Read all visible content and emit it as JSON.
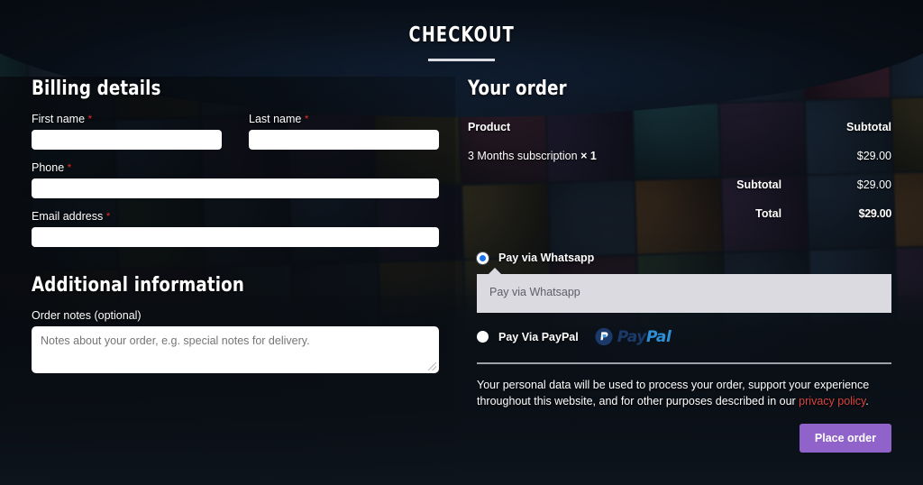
{
  "page": {
    "title": "CHECKOUT"
  },
  "billing": {
    "heading": "Billing details",
    "required_marker": "*",
    "fields": [
      {
        "label": "First name",
        "required": true,
        "value": "",
        "placeholder": ""
      },
      {
        "label": "Last name",
        "required": true,
        "value": "",
        "placeholder": ""
      },
      {
        "label": "Phone",
        "required": true,
        "value": "",
        "placeholder": ""
      },
      {
        "label": "Email address",
        "required": true,
        "value": "",
        "placeholder": ""
      }
    ]
  },
  "additional": {
    "heading": "Additional information",
    "notes_label": "Order notes (optional)",
    "notes_value": "",
    "notes_placeholder": "Notes about your order, e.g. special notes for delivery."
  },
  "order": {
    "heading": "Your order",
    "columns": {
      "product": "Product",
      "subtotal": "Subtotal"
    },
    "items": [
      {
        "name": "3 Months subscription",
        "qty": "× 1",
        "amount": "$29.00"
      }
    ],
    "subtotal_label": "Subtotal",
    "subtotal_amount": "$29.00",
    "total_label": "Total",
    "total_amount": "$29.00"
  },
  "payment": {
    "methods": [
      {
        "label": "Pay via Whatsapp",
        "selected": true,
        "icon": ""
      },
      {
        "label": "Pay Via PayPal",
        "selected": false,
        "icon": "paypal-logo"
      }
    ],
    "description": "Pay via Whatsapp",
    "paypal_logo": {
      "first": "Pay",
      "second": "Pal"
    }
  },
  "privacy": {
    "text_before": "Your personal data will be used to process your order, support your experience throughout this website, and for other purposes described in our ",
    "link": "privacy policy",
    "text_after": "."
  },
  "actions": {
    "place_order": "Place order"
  },
  "colors": {
    "accent_button": "#8f63c9",
    "required": "#e02b27",
    "link": "#d9443f",
    "radio_selected": "#1a73e8",
    "pay_box": "#dcdae1"
  }
}
